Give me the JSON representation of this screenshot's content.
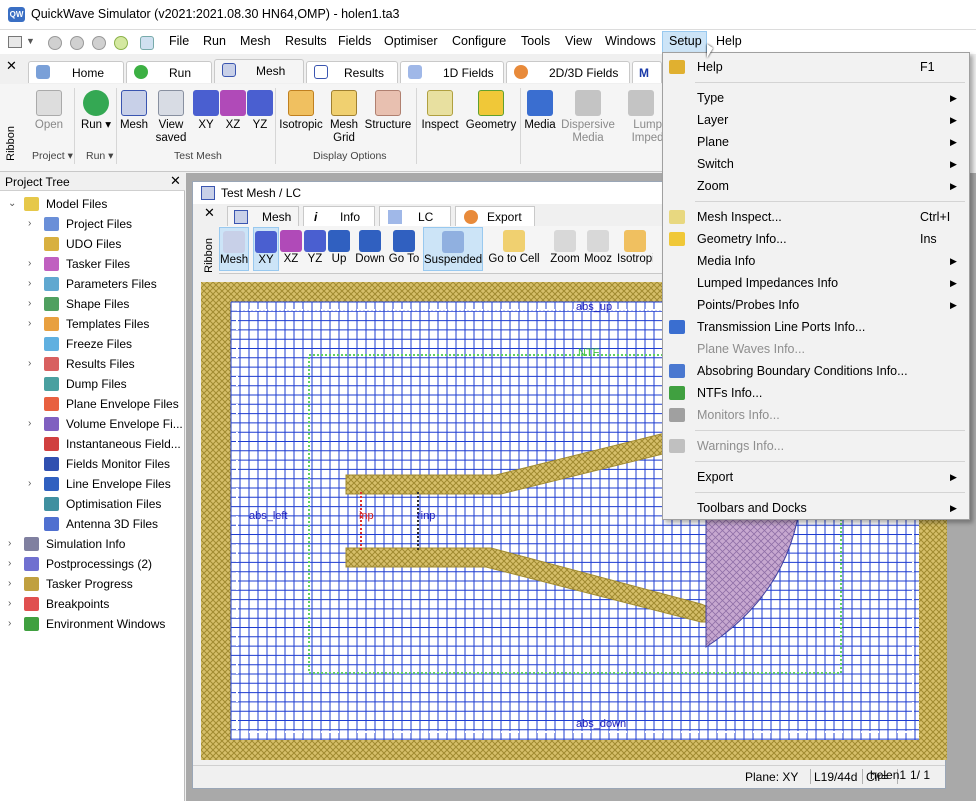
{
  "window": {
    "title": "QuickWave Simulator (v2021:2021.08.30 HN64,OMP) - holen1.ta3",
    "app_icon_text": "QW"
  },
  "menubar": {
    "items": [
      "File",
      "Run",
      "Mesh",
      "Results",
      "Fields",
      "Optimiser",
      "Configure",
      "Tools",
      "View",
      "Windows",
      "Setup",
      "Help"
    ],
    "active": "Setup"
  },
  "ribbon": {
    "tabs": [
      "Home",
      "Run",
      "Mesh",
      "Results",
      "1D Fields",
      "2D/3D Fields",
      "M"
    ],
    "active_tab": "Mesh",
    "side_label": "Ribbon",
    "buttons": [
      {
        "label": "Open",
        "disabled": true
      },
      {
        "label": "Run ▾",
        "disabled": false
      },
      {
        "label": "Mesh",
        "disabled": false
      },
      {
        "label": "View saved",
        "disabled": false
      },
      {
        "label": "XY",
        "disabled": false
      },
      {
        "label": "XZ",
        "disabled": false
      },
      {
        "label": "YZ",
        "disabled": false
      },
      {
        "label": "Isotropic",
        "disabled": false
      },
      {
        "label": "Mesh Grid",
        "disabled": false
      },
      {
        "label": "Structure",
        "disabled": false
      },
      {
        "label": "Inspect",
        "disabled": false
      },
      {
        "label": "Geometry",
        "disabled": false
      },
      {
        "label": "Media",
        "disabled": false
      },
      {
        "label": "Dispersive Media",
        "disabled": true
      },
      {
        "label": "Lumped Impedan",
        "disabled": true
      }
    ],
    "groups": [
      "Project",
      "Run",
      "Test Mesh",
      "Display Options"
    ]
  },
  "project_tree": {
    "title": "Project Tree",
    "items": [
      {
        "label": "Model Files",
        "level": 0,
        "expanded": true
      },
      {
        "label": "Project Files",
        "level": 1,
        "expandable": true
      },
      {
        "label": "UDO Files",
        "level": 1,
        "expandable": false
      },
      {
        "label": "Tasker Files",
        "level": 1,
        "expandable": true
      },
      {
        "label": "Parameters Files",
        "level": 1,
        "expandable": true
      },
      {
        "label": "Shape Files",
        "level": 1,
        "expandable": true
      },
      {
        "label": "Templates Files",
        "level": 1,
        "expandable": true
      },
      {
        "label": "Freeze Files",
        "level": 1,
        "expandable": false
      },
      {
        "label": "Results Files",
        "level": 1,
        "expandable": true
      },
      {
        "label": "Dump Files",
        "level": 1,
        "expandable": false
      },
      {
        "label": "Plane Envelope Files",
        "level": 1,
        "expandable": false
      },
      {
        "label": "Volume Envelope Fi...",
        "level": 1,
        "expandable": true
      },
      {
        "label": "Instantaneous Field...",
        "level": 1,
        "expandable": false
      },
      {
        "label": "Fields Monitor Files",
        "level": 1,
        "expandable": false
      },
      {
        "label": "Line Envelope Files",
        "level": 1,
        "expandable": true
      },
      {
        "label": "Optimisation Files",
        "level": 1,
        "expandable": false
      },
      {
        "label": "Antenna 3D Files",
        "level": 1,
        "expandable": false
      },
      {
        "label": "Simulation Info",
        "level": 0,
        "expandable": true
      },
      {
        "label": "Postprocessings (2)",
        "level": 0,
        "expandable": true
      },
      {
        "label": "Tasker Progress",
        "level": 0,
        "expandable": true
      },
      {
        "label": "Breakpoints",
        "level": 0,
        "expandable": true
      },
      {
        "label": "Environment Windows",
        "level": 0,
        "expandable": true
      }
    ]
  },
  "child_window": {
    "title": "Test Mesh / LC",
    "tabs": [
      "Mesh",
      "Info",
      "LC",
      "Export"
    ],
    "active_tab": "Mesh",
    "side_label": "Ribbon",
    "buttons": [
      "Mesh",
      "XY",
      "XZ",
      "YZ",
      "Up",
      "Down",
      "Go To",
      "Suspended",
      "Go to Cell",
      "Zoom",
      "Mooz",
      "Isotropi"
    ],
    "canvas_labels": [
      "abs_up",
      "NTF",
      "abs_left",
      "inp",
      "rinp",
      "abs_down"
    ],
    "status": {
      "plane": "Plane: XY",
      "layer": "L19/44d",
      "cir": "Cir=",
      "file": "holen1",
      "page": "1/ 1"
    }
  },
  "setup_menu": [
    {
      "label": "Help",
      "shortcut": "F1",
      "icon": "help-icon"
    },
    {
      "sep": true
    },
    {
      "label": "Type",
      "submenu": true
    },
    {
      "label": "Layer",
      "submenu": true
    },
    {
      "label": "Plane",
      "submenu": true
    },
    {
      "label": "Switch",
      "submenu": true
    },
    {
      "label": "Zoom",
      "submenu": true
    },
    {
      "sep": true
    },
    {
      "label": "Mesh Inspect...",
      "shortcut": "Ctrl+I",
      "icon": "mesh-inspect-icon"
    },
    {
      "label": "Geometry Info...",
      "shortcut": "Ins",
      "icon": "geometry-icon"
    },
    {
      "label": "Media Info",
      "submenu": true
    },
    {
      "label": "Lumped Impedances Info",
      "submenu": true
    },
    {
      "label": "Points/Probes Info",
      "submenu": true
    },
    {
      "label": "Transmission Line Ports Info...",
      "icon": "port-icon"
    },
    {
      "label": "Plane Waves Info...",
      "disabled": true
    },
    {
      "label": "Absobring Boundary Conditions Info...",
      "icon": "abc-icon"
    },
    {
      "label": "NTFs Info...",
      "icon": "ntf-icon"
    },
    {
      "label": "Monitors Info...",
      "disabled": true,
      "icon": "monitor-icon"
    },
    {
      "sep": true
    },
    {
      "label": "Warnings Info...",
      "disabled": true,
      "icon": "warning-icon"
    },
    {
      "sep": true
    },
    {
      "label": "Export",
      "submenu": true
    },
    {
      "sep": true
    },
    {
      "label": "Toolbars and Docks",
      "submenu": true
    }
  ],
  "colors": {
    "mesh_line": "#1e3cd0",
    "pec_fill": "#d8c891",
    "highlight": "#cce4f7",
    "accent": "#0078d7"
  }
}
